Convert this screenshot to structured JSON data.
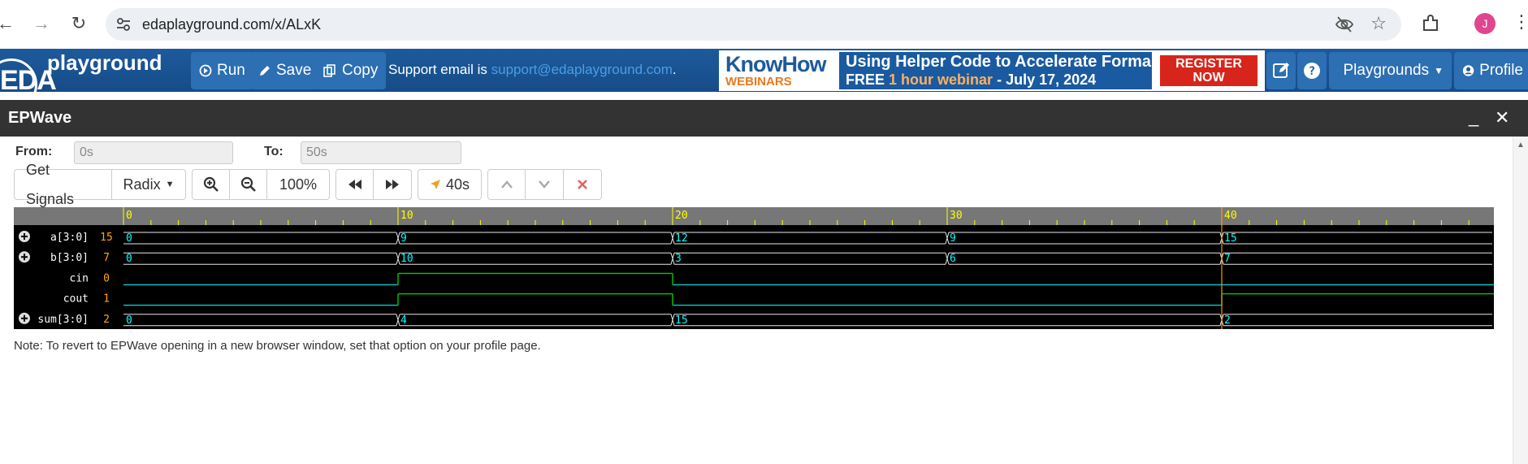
{
  "browser": {
    "url": "edaplayground.com/x/ALxK",
    "avatar_letter": "J"
  },
  "toolbar": {
    "logo_eda": "EDA",
    "logo_playground": "playground",
    "run_label": "Run",
    "save_label": "Save",
    "copy_label": "Copy",
    "support_text": "Support email is",
    "support_email": "support@edaplayground.com",
    "support_suffix": ".",
    "playgrounds_label": "Playgrounds",
    "profile_label": "Profile"
  },
  "banner": {
    "brand": "KnowHow",
    "brand_sub": "WEBINARS",
    "line1": "Using Helper Code to Accelerate Formal",
    "line2_prefix": "FREE",
    "line2_highlight": "1 hour webinar",
    "line2_suffix": "- July 17, 2024",
    "cta_line1": "REGISTER",
    "cta_line2": "NOW"
  },
  "epwave": {
    "title": "EPWave",
    "from_label": "From:",
    "from_value": "0s",
    "to_label": "To:",
    "to_value": "50s",
    "get_signals_label": "Get Signals",
    "radix_label": "Radix",
    "zoom_level": "100%",
    "marker_time": "40s",
    "note": "Note: To revert to EPWave opening in a new browser window, set that option on your profile page."
  },
  "waveform": {
    "time_range": [
      0,
      50
    ],
    "ruler_ticks": [
      "0",
      "10",
      "20",
      "30",
      "40"
    ],
    "cursor_time": 40,
    "signals": [
      {
        "name": "a[3:0]",
        "cursor_value": "15",
        "bus": true,
        "changes": [
          {
            "t": 0,
            "v": "0"
          },
          {
            "t": 10,
            "v": "9"
          },
          {
            "t": 20,
            "v": "12"
          },
          {
            "t": 30,
            "v": "9"
          },
          {
            "t": 40,
            "v": "15"
          }
        ]
      },
      {
        "name": "b[3:0]",
        "cursor_value": "7",
        "bus": true,
        "changes": [
          {
            "t": 0,
            "v": "0"
          },
          {
            "t": 10,
            "v": "10"
          },
          {
            "t": 20,
            "v": "3"
          },
          {
            "t": 30,
            "v": "6"
          },
          {
            "t": 40,
            "v": "7"
          }
        ]
      },
      {
        "name": "cin",
        "cursor_value": "0",
        "bus": false,
        "changes": [
          {
            "t": 0,
            "v": 0
          },
          {
            "t": 10,
            "v": 1
          },
          {
            "t": 20,
            "v": 0
          }
        ]
      },
      {
        "name": "cout",
        "cursor_value": "1",
        "bus": false,
        "changes": [
          {
            "t": 0,
            "v": 0
          },
          {
            "t": 10,
            "v": 1
          },
          {
            "t": 20,
            "v": 0
          },
          {
            "t": 40,
            "v": 1
          }
        ]
      },
      {
        "name": "sum[3:0]",
        "cursor_value": "2",
        "bus": true,
        "changes": [
          {
            "t": 0,
            "v": "0"
          },
          {
            "t": 10,
            "v": "4"
          },
          {
            "t": 20,
            "v": "15"
          },
          {
            "t": 40,
            "v": "2"
          }
        ]
      }
    ]
  },
  "colors": {
    "ruler_text": "#ffff00",
    "bus_value_text": "#00ffff",
    "bus_line": "#e8e8e8",
    "low_line": "#00cccc",
    "high_line": "#00cc00",
    "cursor": "#ff9900",
    "signal_name": "#ffffff",
    "cursor_value": "#ffa500"
  }
}
